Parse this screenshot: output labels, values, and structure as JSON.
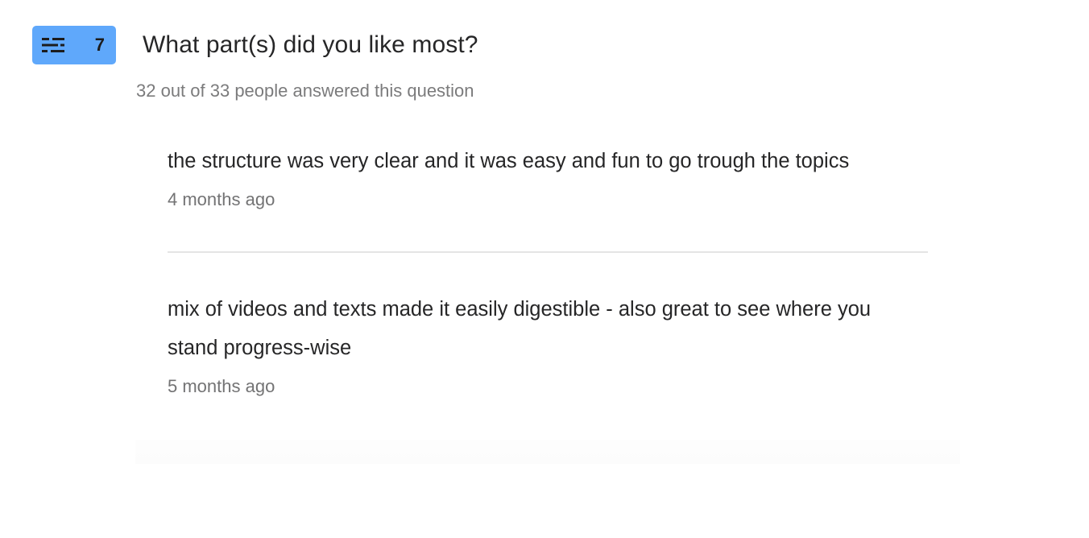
{
  "question": {
    "number": "7",
    "icon": "multiline-text-icon",
    "title": "What part(s) did you like most?",
    "answered_summary": "32 out of 33 people answered this question",
    "badge_color": "#5fa8fb"
  },
  "responses": [
    {
      "text": "the structure was very clear and it was easy and fun to go trough the topics",
      "time": "4 months ago"
    },
    {
      "text": "mix of videos and texts made it easily digestible - also great to see where you stand progress-wise",
      "time": "5 months ago"
    }
  ]
}
